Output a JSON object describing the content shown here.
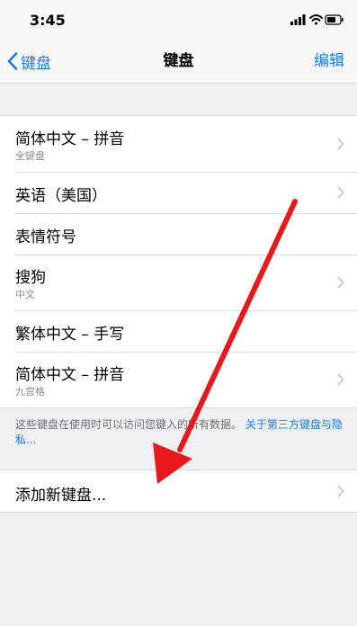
{
  "status": {
    "time": "3:45"
  },
  "nav": {
    "back_label": "键盘",
    "title": "键盘",
    "edit_label": "编辑"
  },
  "keyboards": [
    {
      "title": "简体中文 – 拼音",
      "subtitle": "全键盘"
    },
    {
      "title": "英语（美国）",
      "subtitle": ""
    },
    {
      "title": "表情符号",
      "subtitle": ""
    },
    {
      "title": "搜狗",
      "subtitle": "中文"
    },
    {
      "title": "繁体中文 – 手写",
      "subtitle": ""
    },
    {
      "title": "简体中文 – 拼音",
      "subtitle": "九宫格"
    }
  ],
  "footer": {
    "text": "这些键盘在使用时可以访问您键入的所有数据。",
    "link": "关于第三方键盘与隐私..."
  },
  "add_keyboard": {
    "label": "添加新键盘..."
  },
  "colors": {
    "accent": "#1a7cf5",
    "annotation_arrow": "#e8191a"
  },
  "icons": {
    "back": "chevron-left-icon",
    "row": "chevron-right-icon",
    "signal": "signal-icon",
    "wifi": "wifi-icon",
    "battery": "battery-icon"
  }
}
